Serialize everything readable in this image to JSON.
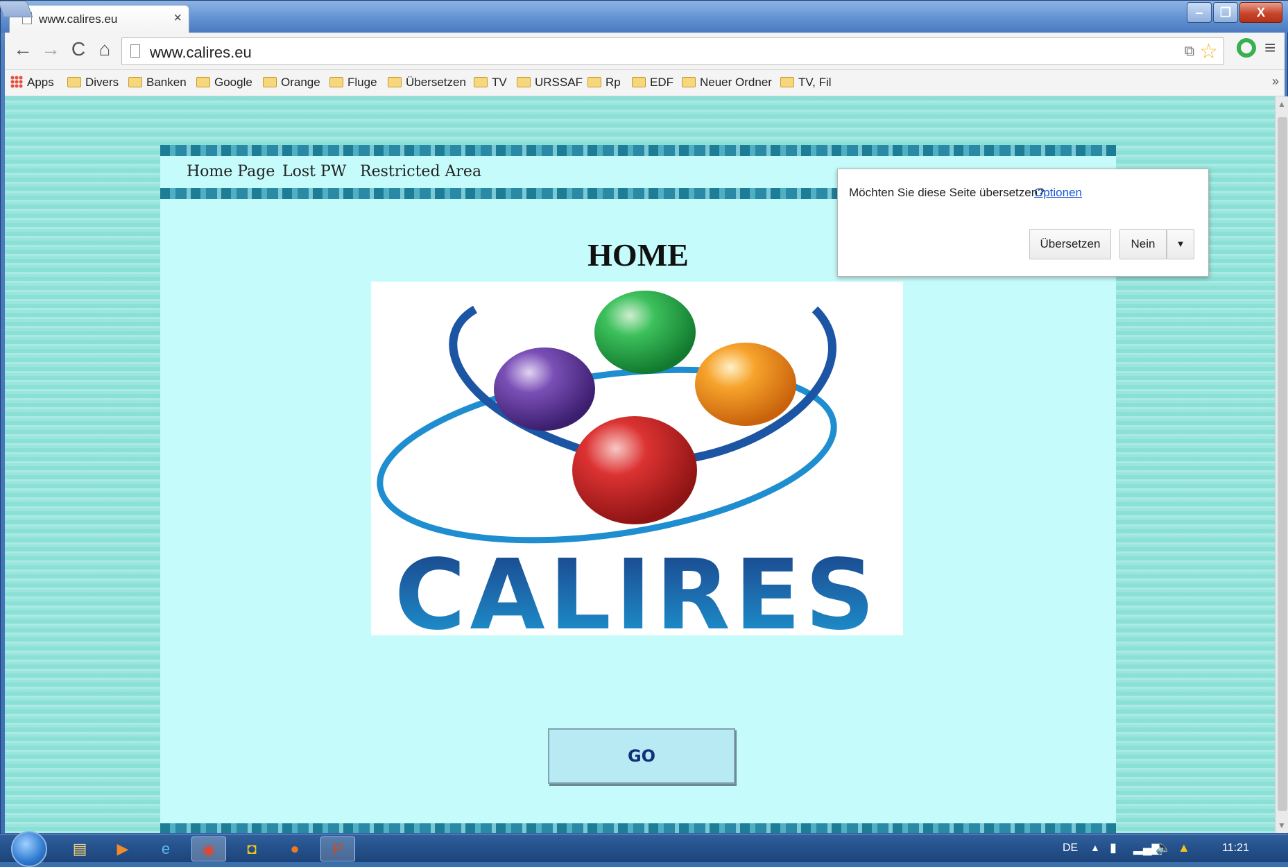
{
  "browser": {
    "tab_title": "www.calires.eu",
    "tab_close": "×",
    "url": "www.calires.eu",
    "window_controls": {
      "minimize": "‒",
      "maximize": "❐",
      "close": "X"
    },
    "nav": {
      "back": "←",
      "forward": "→",
      "reload": "C",
      "home": "⌂",
      "menu": "≡",
      "star": "☆",
      "translate": "⧉"
    }
  },
  "bookmarks": {
    "items": [
      "Apps",
      "Divers",
      "Banken",
      "Google",
      "Orange",
      "Fluge",
      "Übersetzen",
      "TV",
      "URSSAF",
      "Rp",
      "EDF",
      "Neuer Ordner",
      "TV, Fil"
    ],
    "more": "»"
  },
  "translate_popup": {
    "question": "Möchten Sie diese Seite übersetzen?",
    "options_link": "Optionen",
    "translate_button": "Übersetzen",
    "no_button": "Nein",
    "dropdown": "▼"
  },
  "page": {
    "nav_links": [
      "Home Page",
      "Lost PW",
      "Restricted Area"
    ],
    "heading": "HOME",
    "logo_text": "CALIRES",
    "go_button": "GO"
  },
  "taskbar": {
    "language": "DE",
    "tray_arrow": "▲",
    "clock": "11:21",
    "apps": [
      "explorer",
      "media-player",
      "internet-explorer",
      "chrome",
      "outlook",
      "firefox",
      "powerpoint"
    ]
  },
  "colors": {
    "page_background": "#c5fbfa",
    "outer_background": "#8fe3d9",
    "go_button_text": "#12307a",
    "logo_blue": "#1d5fa8",
    "ball_green": "#2bb24c",
    "ball_purple": "#6a3fa0",
    "ball_orange": "#f29a22",
    "ball_red": "#d22a2a"
  }
}
